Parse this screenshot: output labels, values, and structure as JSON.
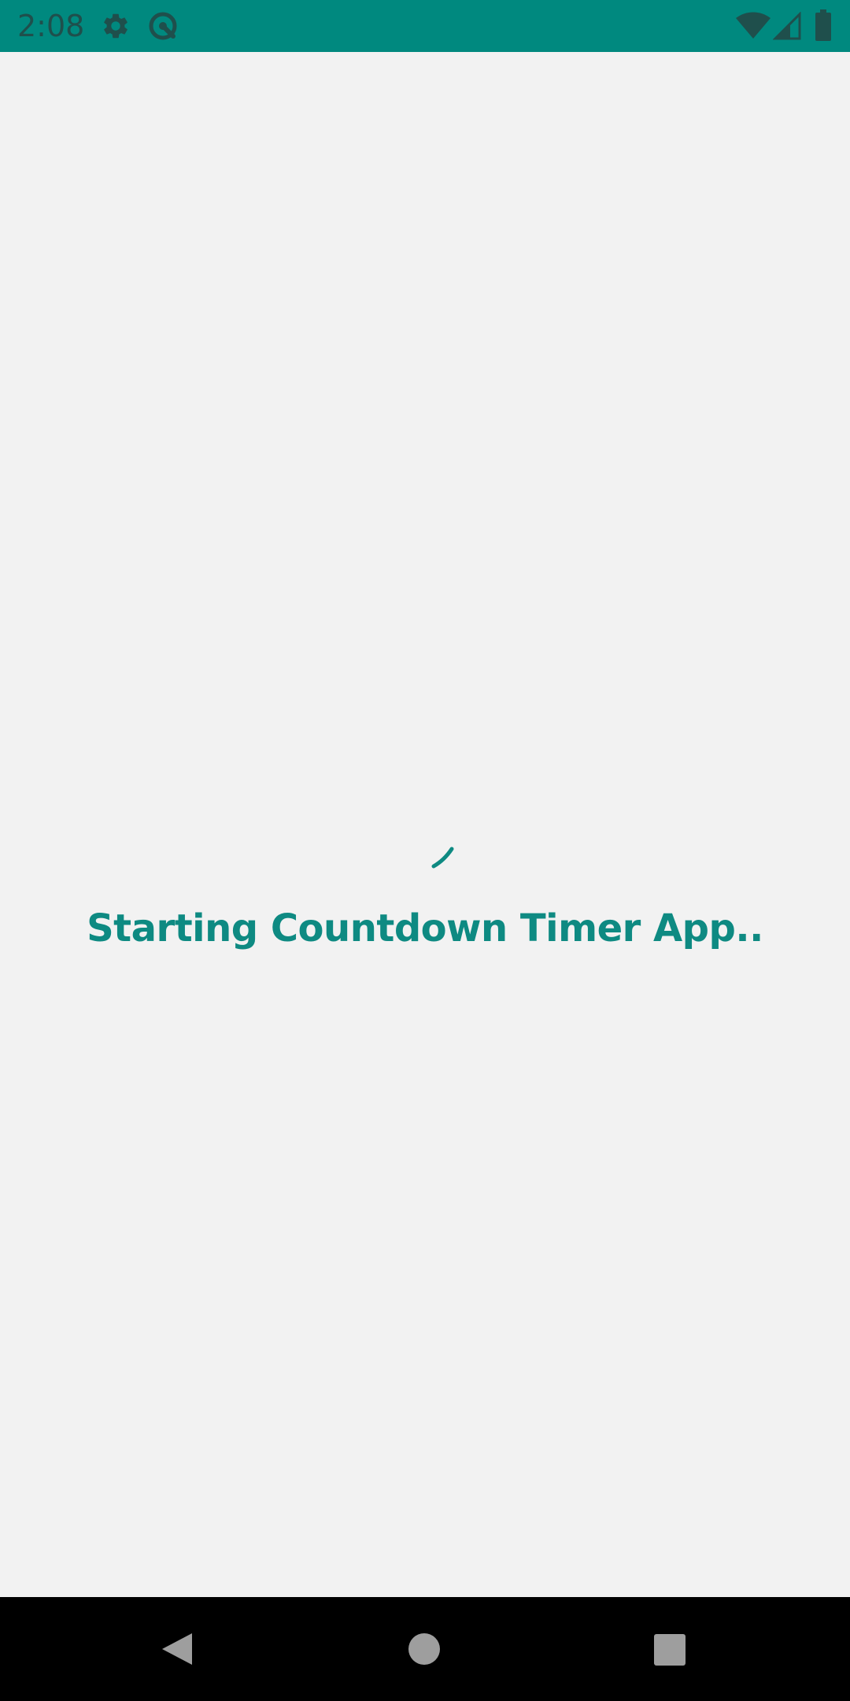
{
  "status_bar": {
    "time": "2:08",
    "background_color": "#00897f",
    "icons": [
      "gear-icon",
      "sync-icon",
      "wifi-icon",
      "signal-icon",
      "battery-icon"
    ]
  },
  "main": {
    "loading_text": "Starting Countdown Timer App..",
    "accent_color": "#0e8a82",
    "background_color": "#f2f2f2",
    "spinner_icon": "progress-spinner-icon"
  },
  "nav_bar": {
    "buttons": [
      "back-button",
      "home-button",
      "recents-button"
    ],
    "background_color": "#000000"
  }
}
